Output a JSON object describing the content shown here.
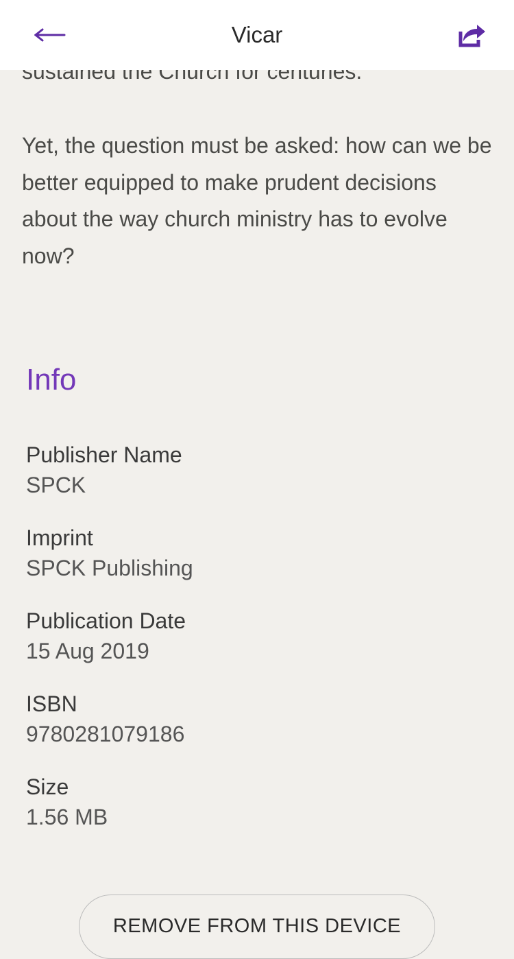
{
  "header": {
    "title": "Vicar"
  },
  "description": {
    "paragraph1": "sustained the Church for centuries.",
    "paragraph2": "Yet, the question must be asked: how can we be better equipped to make prudent decisions about the way church ministry has to evolve now?"
  },
  "info": {
    "heading": "Info",
    "items": [
      {
        "label": "Publisher Name",
        "value": "SPCK"
      },
      {
        "label": "Imprint",
        "value": "SPCK Publishing"
      },
      {
        "label": "Publication Date",
        "value": "15 Aug 2019"
      },
      {
        "label": "ISBN",
        "value": "9780281079186"
      },
      {
        "label": "Size",
        "value": "1.56 MB"
      }
    ]
  },
  "actions": {
    "remove_label": "REMOVE FROM THIS DEVICE"
  }
}
